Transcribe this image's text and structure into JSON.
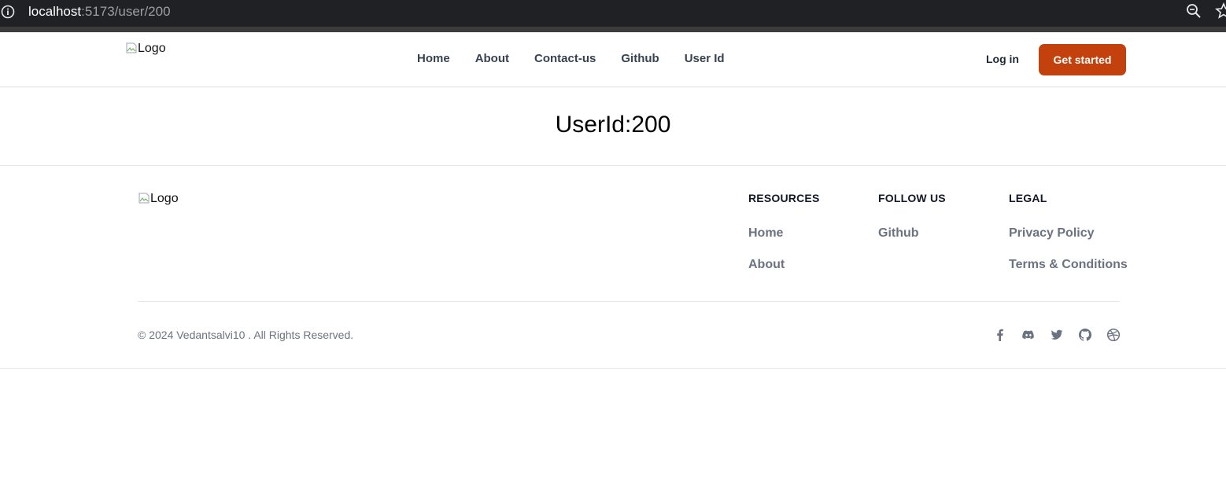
{
  "browser": {
    "url_host": "localhost",
    "url_rest": ":5173/user/200"
  },
  "header": {
    "logo_alt": "Logo",
    "nav": [
      "Home",
      "About",
      "Contact-us",
      "Github",
      "User Id"
    ],
    "login_label": "Log in",
    "cta_label": "Get started",
    "cta_color": "#c2410c"
  },
  "main": {
    "title": "UserId:200"
  },
  "footer": {
    "logo_alt": "Logo",
    "columns": [
      {
        "heading": "RESOURCES",
        "links": [
          "Home",
          "About"
        ]
      },
      {
        "heading": "FOLLOW US",
        "links": [
          "Github"
        ]
      },
      {
        "heading": "LEGAL",
        "links": [
          "Privacy Policy",
          "Terms & Conditions"
        ]
      }
    ],
    "copyright": "© 2024 Vedantsalvi10 . All Rights Reserved.",
    "socials": [
      "facebook-icon",
      "discord-icon",
      "twitter-icon",
      "github-icon",
      "dribbble-icon"
    ]
  }
}
